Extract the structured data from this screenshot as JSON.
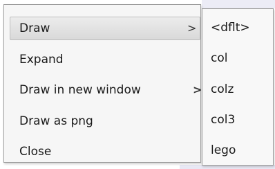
{
  "context_menu": {
    "items": [
      {
        "label": "Draw",
        "has_submenu": true,
        "selected": true
      },
      {
        "label": "Expand",
        "has_submenu": false,
        "selected": false
      },
      {
        "label": "Draw in new window",
        "has_submenu": true,
        "selected": false
      },
      {
        "label": "Draw as png",
        "has_submenu": false,
        "selected": false
      },
      {
        "label": "Close",
        "has_submenu": false,
        "selected": false
      }
    ],
    "submenu_arrow": ">"
  },
  "submenu": {
    "items": [
      {
        "label": "<dflt>"
      },
      {
        "label": "col"
      },
      {
        "label": "colz"
      },
      {
        "label": "col3"
      },
      {
        "label": "lego"
      }
    ]
  }
}
